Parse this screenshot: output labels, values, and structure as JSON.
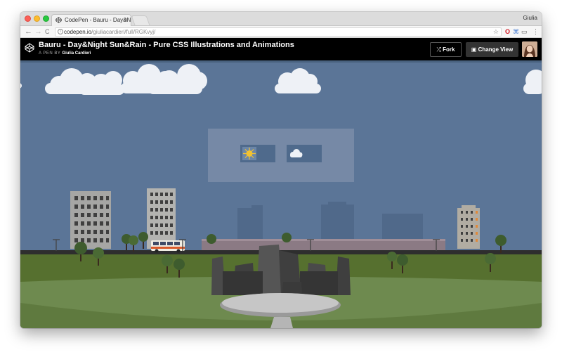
{
  "browser": {
    "tab_title": "CodePen - Bauru - Day&Night",
    "tab_close": "×",
    "profile_name": "Giulia",
    "url_domain": "codepen.io",
    "url_path": "/giuliacardieri/full/RGKvyj/",
    "nav": {
      "back": "←",
      "forward": "→",
      "reload": "C"
    }
  },
  "codepen": {
    "title": "Bauru - Day&Night Sun&Rain - Pure CSS Illustrations and Animations",
    "by_prefix": "A PEN BY",
    "author": "Giulia Cardieri",
    "fork_label": "Fork",
    "change_view_label": "Change View"
  },
  "scene": {
    "colors": {
      "sky": "#5b7597",
      "ground": "#56702f",
      "plaza": "#6e8a4f",
      "road": "#2e2e2e",
      "panel": "#7689a6",
      "weather_button": "#4f6a8c"
    },
    "weather_controls": [
      {
        "name": "sun",
        "icon": "sun-icon"
      },
      {
        "name": "rain",
        "icon": "cloud-icon"
      }
    ]
  }
}
